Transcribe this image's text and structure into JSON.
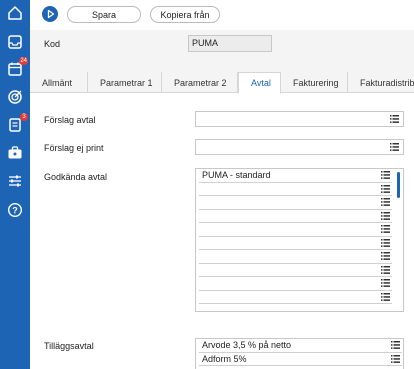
{
  "sidebar": {
    "icons": [
      {
        "name": "home-icon"
      },
      {
        "name": "inbox-icon"
      },
      {
        "name": "calendar-icon",
        "badge": "24"
      },
      {
        "name": "target-icon"
      },
      {
        "name": "document-icon",
        "badge": "3"
      },
      {
        "name": "briefcase-icon"
      },
      {
        "name": "sliders-icon"
      },
      {
        "name": "help-icon"
      }
    ]
  },
  "toolbar": {
    "save_label": "Spara",
    "copy_label": "Kopiera från"
  },
  "header": {
    "kod_label": "Kod",
    "kod_value": "PUMA"
  },
  "tabs": [
    {
      "label": "Allmänt",
      "active": false
    },
    {
      "label": "Parametrar 1",
      "active": false
    },
    {
      "label": "Parametrar 2",
      "active": false
    },
    {
      "label": "Avtal",
      "active": true
    },
    {
      "label": "Fakturering",
      "active": false
    },
    {
      "label": "Fakturadistribution",
      "active": false
    }
  ],
  "form": {
    "forslag_avtal_label": "Förslag avtal",
    "forslag_avtal_value": "",
    "forslag_ej_print_label": "Förslag ej print",
    "forslag_ej_print_value": "",
    "godkanda_avtal_label": "Godkända avtal",
    "godkanda_avtal": [
      "PUMA - standard",
      "",
      "",
      "",
      "",
      "",
      "",
      "",
      "",
      ""
    ],
    "tillaggsavtal_label": "Tilläggsavtal",
    "tillaggsavtal": [
      "Arvode 3,5 % på netto",
      "Adform 5%"
    ]
  },
  "colors": {
    "primary": "#1e64b4",
    "badge": "#e53935",
    "header_bg": "#f4f4f4",
    "border": "#c8c8c8"
  }
}
